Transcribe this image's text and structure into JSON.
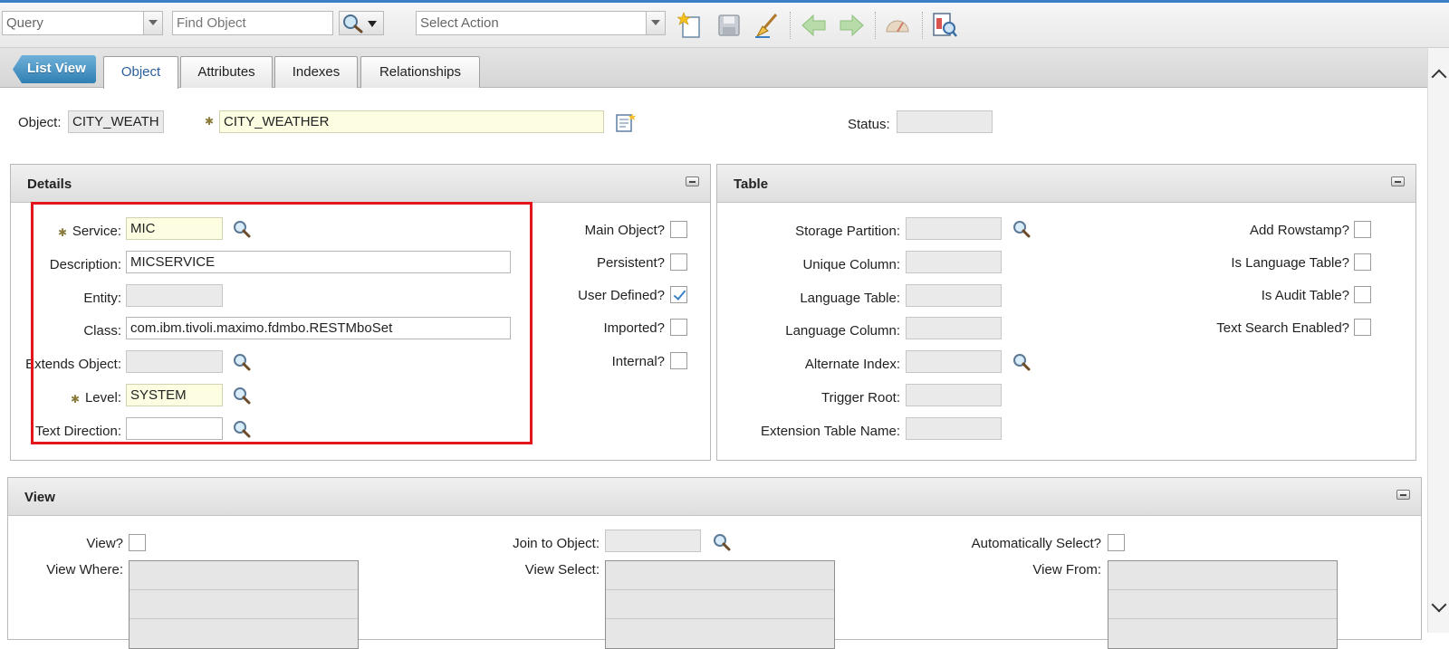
{
  "toolbar": {
    "query_value": "Query",
    "find_placeholder": "Find Object",
    "action_value": "Select Action",
    "icons": [
      "new-record-icon",
      "save-icon",
      "clear-changes-icon",
      "previous-record-icon",
      "next-record-icon",
      "search-gauge-icon",
      "view-history-icon"
    ]
  },
  "tabs": {
    "list_view": "List View",
    "items": [
      "Object",
      "Attributes",
      "Indexes",
      "Relationships"
    ],
    "active": "Object"
  },
  "header": {
    "object_label": "Object:",
    "object_value": "CITY_WEATH",
    "object_desc": "CITY_WEATHER",
    "status_label": "Status:",
    "status_value": ""
  },
  "details": {
    "title": "Details",
    "service_label": "Service:",
    "service_value": "MIC",
    "description_label": "Description:",
    "description_value": "MICSERVICE",
    "entity_label": "Entity:",
    "entity_value": "",
    "class_label": "Class:",
    "class_value": "com.ibm.tivoli.maximo.fdmbo.RESTMboSet",
    "extends_label": "Extends Object:",
    "extends_value": "",
    "level_label": "Level:",
    "level_value": "SYSTEM",
    "textdir_label": "Text Direction:",
    "textdir_value": "",
    "main_object_label": "Main Object?",
    "persistent_label": "Persistent?",
    "user_defined_label": "User Defined?",
    "imported_label": "Imported?",
    "internal_label": "Internal?"
  },
  "table": {
    "title": "Table",
    "storage_label": "Storage Partition:",
    "unique_label": "Unique Column:",
    "lang_table_label": "Language Table:",
    "lang_column_label": "Language Column:",
    "alt_index_label": "Alternate Index:",
    "trigger_label": "Trigger Root:",
    "ext_table_label": "Extension Table Name:",
    "rowstamp_label": "Add Rowstamp?",
    "is_lang_label": "Is Language Table?",
    "is_audit_label": "Is Audit Table?",
    "text_search_label": "Text Search Enabled?"
  },
  "view": {
    "title": "View",
    "view_label": "View?",
    "view_where_label": "View Where:",
    "join_label": "Join to Object:",
    "view_select_label": "View Select:",
    "auto_select_label": "Automatically Select?",
    "view_from_label": "View From:"
  },
  "colors": {
    "accent": "#2f7fb3",
    "highlight_box": "#e2141c",
    "required_bg": "#fdfde2"
  }
}
